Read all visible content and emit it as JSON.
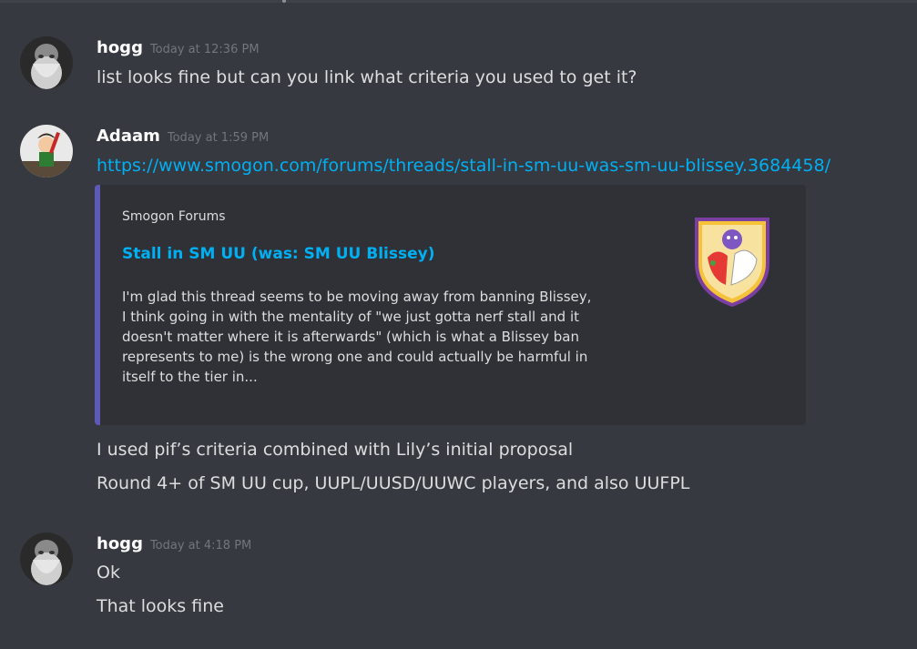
{
  "messages": [
    {
      "username": "hogg",
      "timestamp": "Today at 12:36 PM",
      "lines": [
        "list looks fine but can you link what criteria you used to get it?"
      ]
    },
    {
      "username": "Adaam",
      "timestamp": "Today at 1:59 PM",
      "link": "https://www.smogon.com/forums/threads/stall-in-sm-uu-was-sm-uu-blissey.3684458/",
      "embed": {
        "provider": "Smogon Forums",
        "title": "Stall in SM UU (was: SM UU Blissey)",
        "description_lines": [
          "I'm glad this thread seems to be moving away from banning Blissey,",
          "I think going in with the mentality of \"we just gotta nerf stall and it",
          "doesn't matter where it is afterwards\" (which is what a Blissey ban",
          "represents to me) is the wrong one and could actually be harmful in",
          "itself to the tier in..."
        ],
        "accent_color": "#5e58b6",
        "thumbnail_icon": "smogon-shield-logo-icon"
      },
      "lines": [
        "I used pif’s criteria combined with Lily’s initial proposal",
        "Round 4+ of SM UU cup, UUPL/UUSD/UUWC players, and also UUFPL"
      ]
    },
    {
      "username": "hogg",
      "timestamp": "Today at 4:18 PM",
      "lines": [
        "Ok",
        "That looks fine"
      ]
    }
  ],
  "colors": {
    "background": "#36393f",
    "link": "#00b0f4",
    "username": "#ffffff",
    "timestamp": "#72767d",
    "text": "#dcddde"
  }
}
